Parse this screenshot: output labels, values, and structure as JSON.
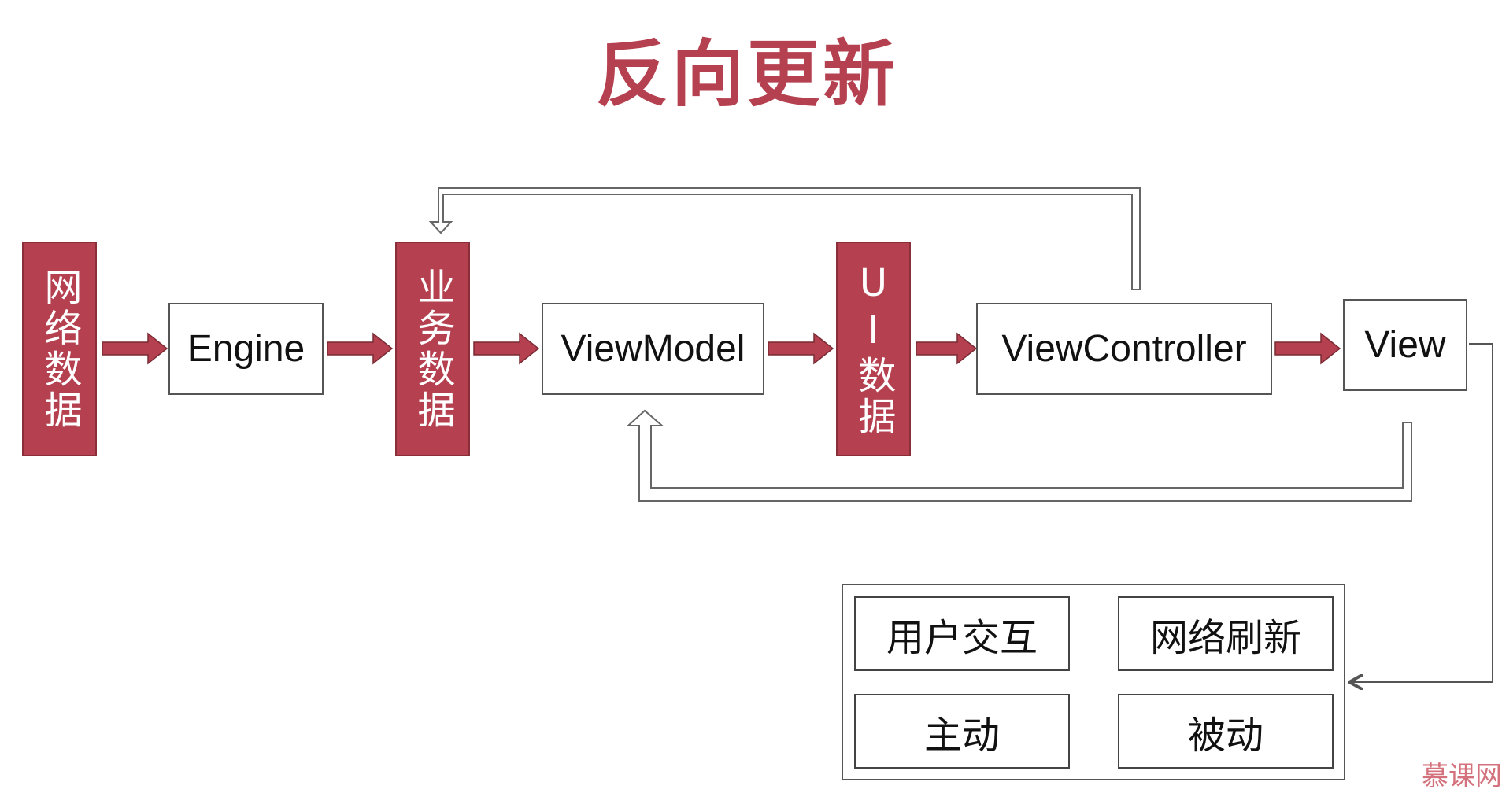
{
  "title": "反向更新",
  "colors": {
    "accent": "#b5404f",
    "arrow": "#b5404f",
    "border": "#555555"
  },
  "nodes": {
    "network_data": "网络数据",
    "engine": "Engine",
    "business_data": "业务数据",
    "viewmodel": "ViewModel",
    "ui_data": "UI数据",
    "viewcontroller": "ViewController",
    "view": "View"
  },
  "triggers": {
    "user_interaction": "用户交互",
    "network_refresh": "网络刷新",
    "active": "主动",
    "passive": "被动"
  },
  "watermark": "慕课网"
}
